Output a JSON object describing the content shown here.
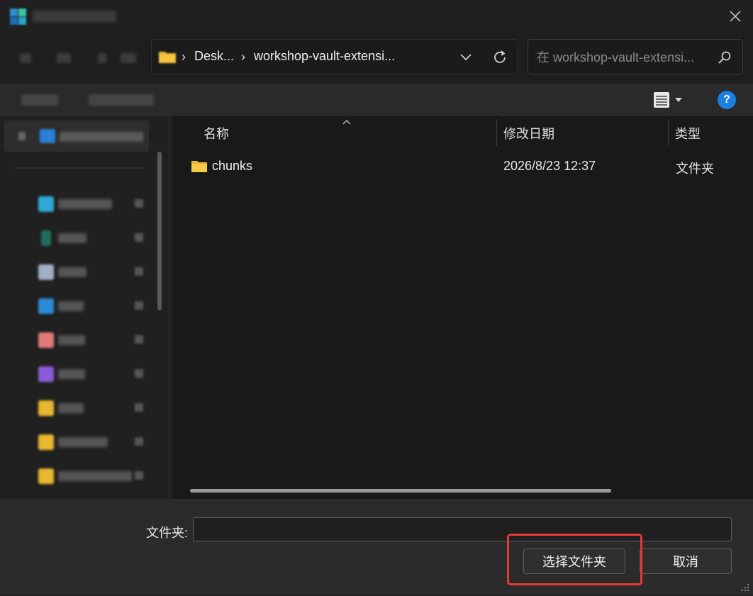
{
  "window": {
    "title": ""
  },
  "path": {
    "crumbs": [
      "Desk...",
      "workshop-vault-extensi..."
    ],
    "separator": "›"
  },
  "search": {
    "placeholder": "在 workshop-vault-extensi..."
  },
  "help": {
    "label": "?"
  },
  "columns": {
    "name": "名称",
    "date": "修改日期",
    "type": "类型"
  },
  "files": [
    {
      "name": "chunks",
      "date": "2026/8/23 12:37",
      "type": "文件夹"
    }
  ],
  "bottom": {
    "folder_label": "文件夹:",
    "folder_value": "",
    "select_button": "选择文件夹",
    "cancel_button": "取消"
  },
  "colors": {
    "accent": "#1a7fe0",
    "highlight": "#e53935",
    "folder": "#f5c542"
  },
  "icons": [
    "app-icon",
    "close-icon",
    "folder-icon",
    "chevron-down-icon",
    "refresh-icon",
    "search-icon",
    "view-list-icon",
    "help-icon"
  ]
}
